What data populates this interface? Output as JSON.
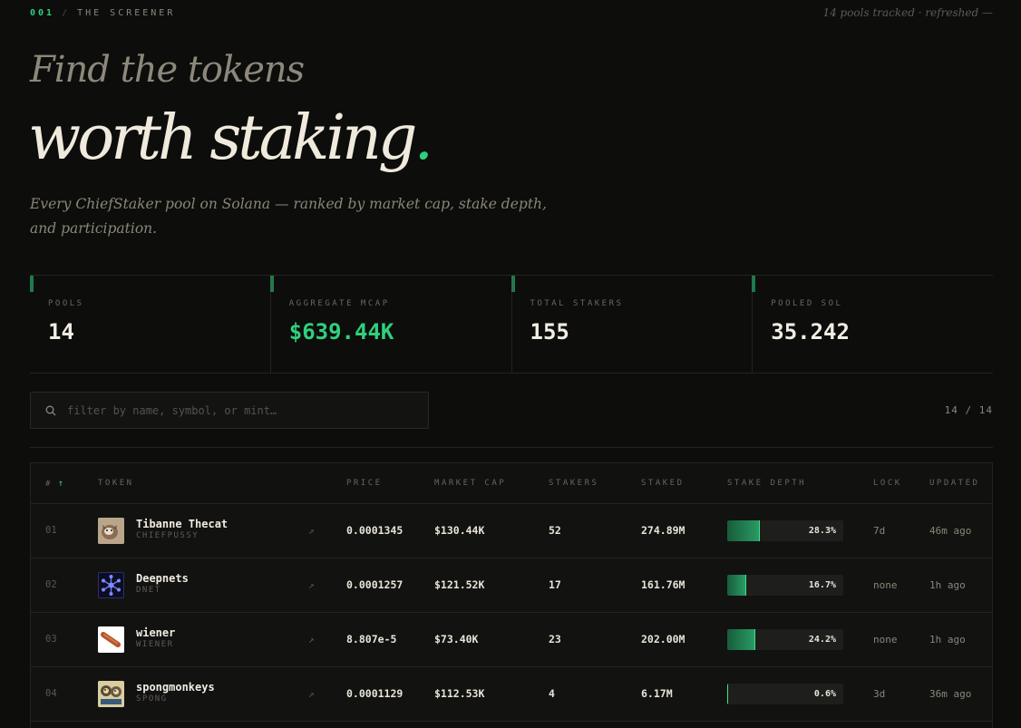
{
  "header": {
    "section_num": "001",
    "section_sep": "/",
    "section_title": "THE SCREENER",
    "tracked": "14 pools tracked · refreshed —"
  },
  "hero": {
    "line1": "Find the tokens",
    "line2": "worth staking",
    "line2_dot": ".",
    "subtitle": "Every ChiefStaker pool on Solana — ranked by market cap, stake depth, and participation."
  },
  "stats": [
    {
      "label": "POOLS",
      "value": "14"
    },
    {
      "label": "AGGREGATE MCAP",
      "value": "$639.44K"
    },
    {
      "label": "TOTAL STAKERS",
      "value": "155"
    },
    {
      "label": "POOLED SOL",
      "value": "35.242"
    }
  ],
  "search": {
    "placeholder": "filter by name, symbol, or mint…",
    "value": "",
    "count": "14 / 14"
  },
  "table": {
    "columns": {
      "num": "#",
      "num_sort": "↑",
      "token": "TOKEN",
      "price": "PRICE",
      "mcap": "MARKET CAP",
      "stakers": "STAKERS",
      "staked": "STAKED",
      "depth": "STAKE DEPTH",
      "lock": "LOCK",
      "updated": "UPDATED"
    },
    "rows": [
      {
        "num": "01",
        "name": "Tibanne Thecat",
        "symbol": "CHIEFPUSSY",
        "link": "↗",
        "price": "0.0001345",
        "mcap": "$130.44K",
        "stakers": "52",
        "staked": "274.89M",
        "depth": 0.283,
        "depth_label": "28.3%",
        "lock": "7d",
        "updated": "46m ago",
        "icon": "cat-photo-icon"
      },
      {
        "num": "02",
        "name": "Deepnets",
        "symbol": "DNET",
        "link": "↗",
        "price": "0.0001257",
        "mcap": "$121.52K",
        "stakers": "17",
        "staked": "161.76M",
        "depth": 0.167,
        "depth_label": "16.7%",
        "lock": "none",
        "updated": "1h ago",
        "icon": "network-node-icon"
      },
      {
        "num": "03",
        "name": "wiener",
        "symbol": "WIENER",
        "link": "↗",
        "price": "8.807e-5",
        "mcap": "$73.40K",
        "stakers": "23",
        "staked": "202.00M",
        "depth": 0.242,
        "depth_label": "24.2%",
        "lock": "none",
        "updated": "1h ago",
        "icon": "sausage-icon"
      },
      {
        "num": "04",
        "name": "spongmonkeys",
        "symbol": "SPONG",
        "link": "↗",
        "price": "0.0001129",
        "mcap": "$112.53K",
        "stakers": "4",
        "staked": "6.17M",
        "depth": 0.006,
        "depth_label": "0.6%",
        "lock": "3d",
        "updated": "36m ago",
        "icon": "monkey-photo-icon"
      }
    ]
  },
  "colors": {
    "accent": "#2fd07c",
    "background": "#0d0d0c",
    "depth_fill": "#1f7a4c"
  }
}
